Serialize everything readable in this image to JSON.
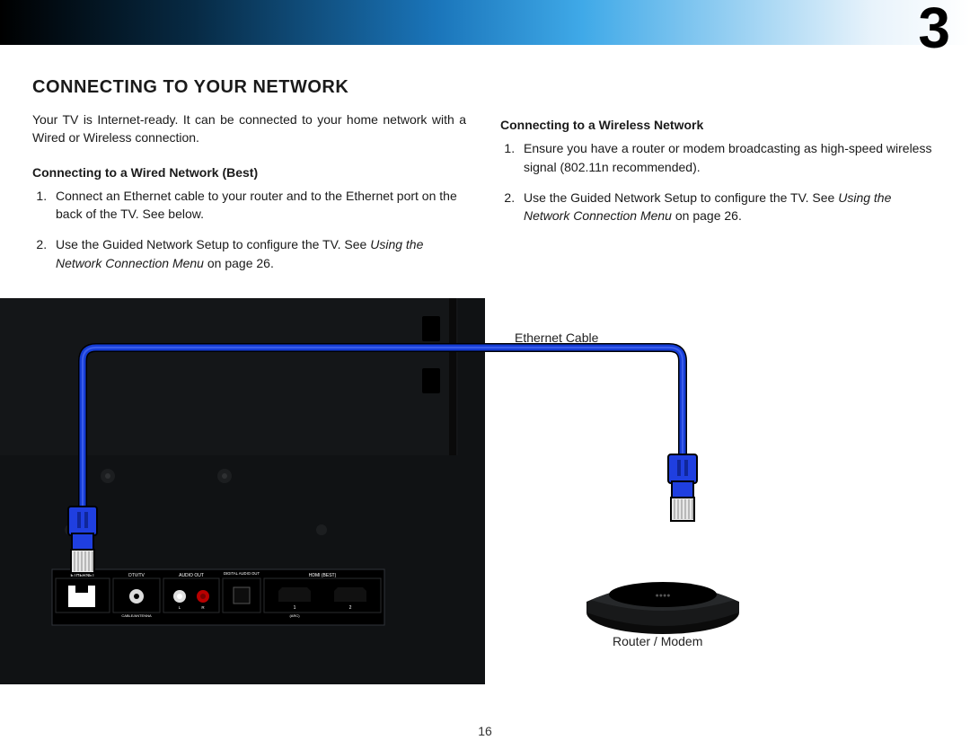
{
  "chapter_number": "3",
  "section_title": "CONNECTING TO YOUR NETWORK",
  "intro": "Your TV is Internet-ready. It can be connected to your home network with a Wired or Wireless connection.",
  "wired": {
    "heading": "Connecting to a Wired Network (Best)",
    "step1": "Connect an Ethernet cable to your router and to the Ethernet port on the back of the TV. See below.",
    "step2a": "Use the Guided Network Setup to configure the TV. See ",
    "step2b": "Using the Network Connection Menu",
    "step2c": " on page 26."
  },
  "wireless": {
    "heading": "Connecting to a Wireless Network",
    "step1": "Ensure you have a router or modem broadcasting as high-speed wireless signal (802.11n recommended).",
    "step2a": "Use the Guided Network Setup to configure the TV. See ",
    "step2b": "Using the Network Connection Menu",
    "step2c": " on page 26."
  },
  "labels": {
    "ethernet_cable": "Ethernet Cable",
    "router_modem": "Router / Modem"
  },
  "ports": {
    "ethernet": "ETHERNET",
    "dtv": "DTV/TV",
    "cable": "CABLE/ANTENNA",
    "audio_out": "AUDIO OUT",
    "l": "L",
    "r": "R",
    "digital": "DIGITAL AUDIO OUT",
    "hdmi": "HDMI (BEST)",
    "one": "1",
    "two": "2",
    "arc": "(ARC)"
  },
  "page_number": "16"
}
